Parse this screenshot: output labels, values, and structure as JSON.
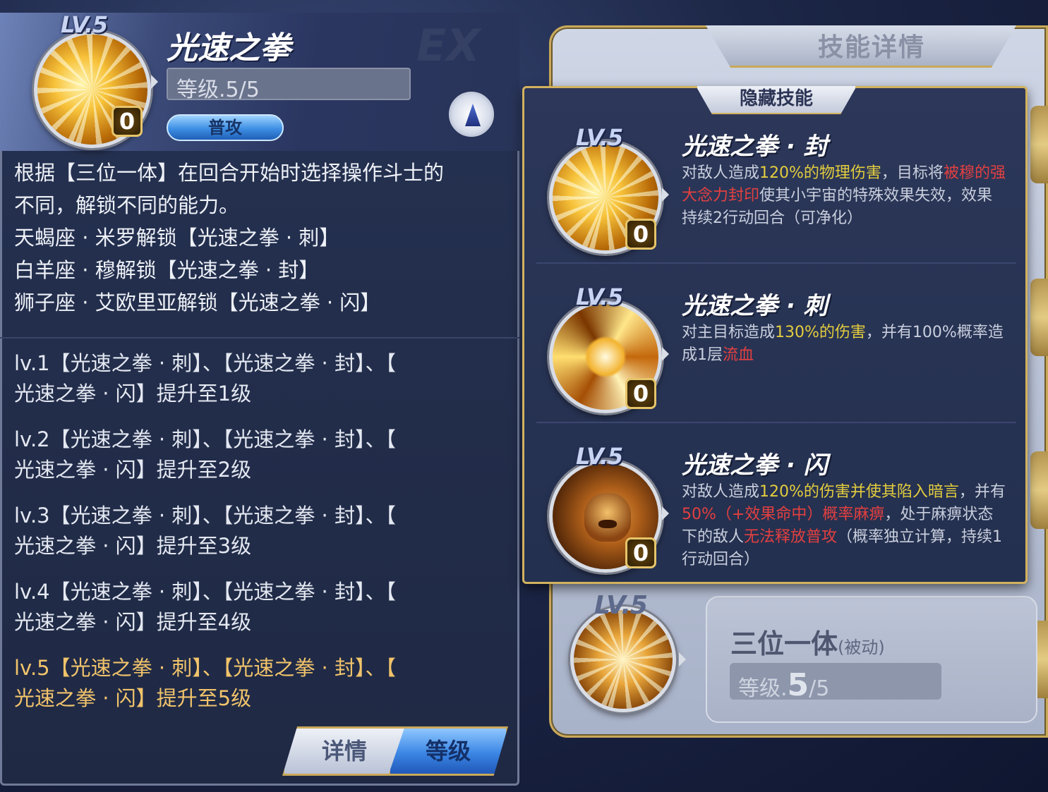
{
  "background": {
    "title": "技能详情",
    "passive_skill": {
      "lv": "LV.5",
      "name": "三位一体",
      "tag": "(被动)",
      "level_prefix": "等级.",
      "level_current": "5",
      "level_max": "/5"
    }
  },
  "main_skill": {
    "lv": "LV.5",
    "name": "光速之拳",
    "level": "等级.5/5",
    "type": "普攻",
    "badge": "0",
    "description": [
      "根据【三位一体】在回合开始时选择操作斗士的",
      "不同，解锁不同的能力。",
      "天蝎座 · 米罗解锁【光速之拳 · 刺】",
      "白羊座 · 穆解锁【光速之拳 · 封】",
      "狮子座 · 艾欧里亚解锁【光速之拳 · 闪】"
    ],
    "levels": [
      {
        "l1": "lv.1【光速之拳 · 刺】、【光速之拳 · 封】、【",
        "l2": "光速之拳 · 闪】提升至1级"
      },
      {
        "l1": "lv.2【光速之拳 · 刺】、【光速之拳 · 封】、【",
        "l2": "光速之拳 · 闪】提升至2级"
      },
      {
        "l1": "lv.3【光速之拳 · 刺】、【光速之拳 · 封】、【",
        "l2": "光速之拳 · 闪】提升至3级"
      },
      {
        "l1": "lv.4【光速之拳 · 刺】、【光速之拳 · 封】、【",
        "l2": "光速之拳 · 闪】提升至4级"
      },
      {
        "l1": "lv.5【光速之拳 · 刺】、【光速之拳 · 封】、【",
        "l2": "光速之拳 · 闪】提升至5级"
      }
    ],
    "current_level_index": 4,
    "tabs": {
      "detail": "详情",
      "level": "等级"
    },
    "active_tab": "level"
  },
  "hidden_skills": {
    "header": "隐藏技能",
    "items": [
      {
        "lv": "LV.5",
        "badge": "0",
        "name": "光速之拳 · 封",
        "desc_parts": [
          {
            "t": "对敌人造成",
            "c": "n"
          },
          {
            "t": "120%的物理伤害",
            "c": "y"
          },
          {
            "t": "，目标将",
            "c": "n"
          },
          {
            "t": "被穆的强大念力封印",
            "c": "r"
          },
          {
            "t": "使其小宇宙的特殊效果失效，效果持续2行动回合（可净化）",
            "c": "n"
          }
        ]
      },
      {
        "lv": "LV.5",
        "badge": "0",
        "name": "光速之拳 · 刺",
        "desc_parts": [
          {
            "t": "对主目标造成",
            "c": "n"
          },
          {
            "t": "130%的伤害",
            "c": "y"
          },
          {
            "t": "，并有100%概率造成1层",
            "c": "n"
          },
          {
            "t": "流血",
            "c": "r"
          }
        ]
      },
      {
        "lv": "LV.5",
        "badge": "0",
        "name": "光速之拳 · 闪",
        "desc_parts": [
          {
            "t": "对敌人造成",
            "c": "n"
          },
          {
            "t": "120%的伤害并使其陷入暗言",
            "c": "y"
          },
          {
            "t": "，并有",
            "c": "n"
          },
          {
            "t": "50%（+效果命中）概率麻痹",
            "c": "r"
          },
          {
            "t": "，处于麻痹状态下的敌人",
            "c": "n"
          },
          {
            "t": "无法释放普攻",
            "c": "r"
          },
          {
            "t": "（概率独立计算，持续1行动回合）",
            "c": "n"
          }
        ]
      }
    ]
  },
  "colors": {
    "highlight_yellow": "#e3cd3e",
    "highlight_red": "#e24040",
    "current_level": "#f1c36b",
    "gold_border": "#d2b25e"
  }
}
